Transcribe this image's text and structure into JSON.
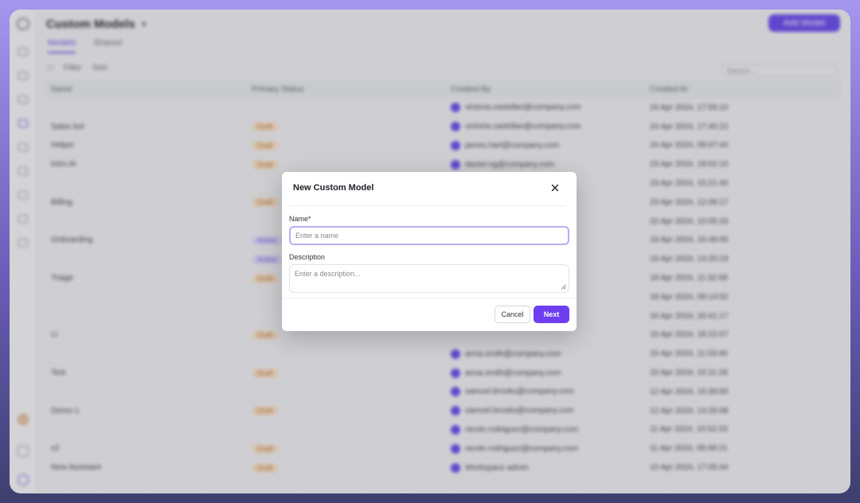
{
  "background": {
    "header_title": "Custom Models",
    "add_button": "Add Model",
    "tabs": [
      "Models",
      "Shared"
    ],
    "toolbar": [
      "Filter",
      "Sort"
    ],
    "search_placeholder": "Search...",
    "columns": [
      "Name",
      "Primary Status",
      "Created By",
      "Created At"
    ],
    "rows": [
      {
        "name": "",
        "status": "",
        "status_color": "",
        "creator": "victoria.castellan@company.com",
        "date": "24 Apr 2024, 17:55:10"
      },
      {
        "name": "Sales bot",
        "status": "Draft",
        "status_color": "orange",
        "creator": "victoria.castellan@company.com",
        "date": "24 Apr 2024, 17:40:22"
      },
      {
        "name": "Helper",
        "status": "Draft",
        "status_color": "orange",
        "creator": "james.hart@company.com",
        "date": "24 Apr 2024, 09:07:44"
      },
      {
        "name": "Intro AI",
        "status": "Draft",
        "status_color": "orange",
        "creator": "daniel.ng@company.com",
        "date": "23 Apr 2024, 18:02:10"
      },
      {
        "name": "",
        "status": "",
        "status_color": "",
        "creator": "",
        "date": "23 Apr 2024, 15:21:40"
      },
      {
        "name": "Billing",
        "status": "Draft",
        "status_color": "orange",
        "creator": "",
        "date": "23 Apr 2024, 12:08:17"
      },
      {
        "name": "",
        "status": "",
        "status_color": "",
        "creator": "",
        "date": "22 Apr 2024, 10:05:33"
      },
      {
        "name": "Onboarding",
        "status": "Active",
        "status_color": "purple",
        "creator": "",
        "date": "19 Apr 2024, 16:48:05"
      },
      {
        "name": "",
        "status": "Active",
        "status_color": "purple",
        "creator": "",
        "date": "19 Apr 2024, 14:20:19"
      },
      {
        "name": "Triage",
        "status": "Draft",
        "status_color": "orange",
        "creator": "",
        "date": "18 Apr 2024, 11:32:58"
      },
      {
        "name": "",
        "status": "",
        "status_color": "",
        "creator": "",
        "date": "18 Apr 2024, 09:14:02"
      },
      {
        "name": "",
        "status": "",
        "status_color": "",
        "creator": "",
        "date": "16 Apr 2024, 20:41:17"
      },
      {
        "name": "Lt",
        "status": "Draft",
        "status_color": "orange",
        "creator": "",
        "date": "16 Apr 2024, 18:22:07"
      },
      {
        "name": "",
        "status": "",
        "status_color": "",
        "creator": "anna.smith@company.com",
        "date": "15 Apr 2024, 11:03:46"
      },
      {
        "name": "Test",
        "status": "Draft",
        "status_color": "orange",
        "creator": "anna.smith@company.com",
        "date": "15 Apr 2024, 10:11:28"
      },
      {
        "name": "",
        "status": "",
        "status_color": "",
        "creator": "samuel.brooks@company.com",
        "date": "12 Apr 2024, 15:39:50"
      },
      {
        "name": "Demo-1",
        "status": "Draft",
        "status_color": "orange",
        "creator": "samuel.brooks@company.com",
        "date": "12 Apr 2024, 14:26:08"
      },
      {
        "name": "",
        "status": "",
        "status_color": "",
        "creator": "nicole.rodriguez@company.com",
        "date": "11 Apr 2024, 10:52:33"
      },
      {
        "name": "v2",
        "status": "Draft",
        "status_color": "orange",
        "creator": "nicole.rodriguez@company.com",
        "date": "11 Apr 2024, 09:48:21"
      },
      {
        "name": "New Assistant",
        "status": "Draft",
        "status_color": "orange",
        "creator": "Workspace admin",
        "date": "10 Apr 2024, 17:05:44"
      }
    ]
  },
  "modal": {
    "title": "New Custom Model",
    "name_label": "Name*",
    "name_placeholder": "Enter a name",
    "name_value": "",
    "description_label": "Description",
    "description_placeholder": "Enter a description...",
    "description_value": "",
    "cancel_label": "Cancel",
    "next_label": "Next"
  },
  "colors": {
    "accent": "#6d3ff0",
    "focus_ring": "#b9acf5"
  },
  "icons": {
    "close": "close-icon",
    "resize": "resize-handle-icon"
  }
}
